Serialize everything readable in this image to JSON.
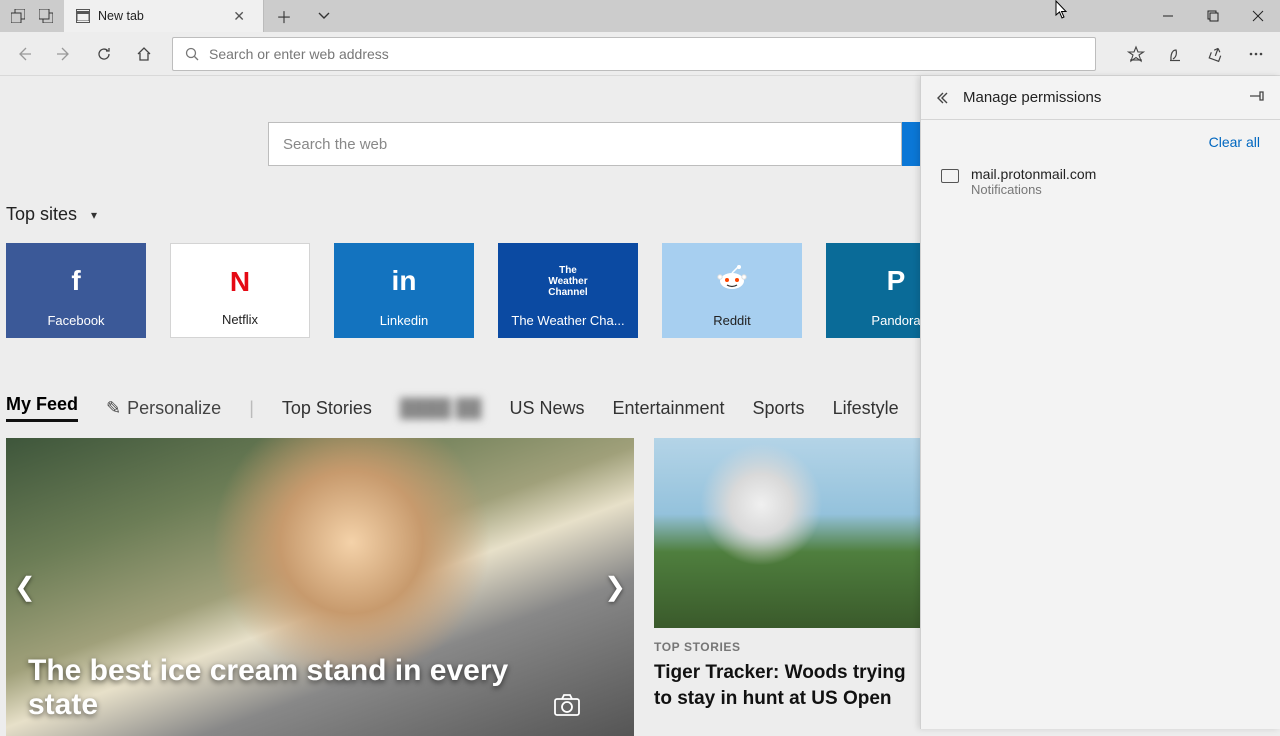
{
  "tab": {
    "title": "New tab"
  },
  "addressbar": {
    "placeholder": "Search or enter web address"
  },
  "websearch": {
    "placeholder": "Search the web"
  },
  "topsites": {
    "heading": "Top sites",
    "tiles": [
      {
        "label": "Facebook"
      },
      {
        "label": "Netflix"
      },
      {
        "label": "Linkedin"
      },
      {
        "label": "The Weather Cha..."
      },
      {
        "label": "Reddit"
      },
      {
        "label": "Pandora"
      }
    ]
  },
  "feed": {
    "tabs": {
      "my_feed": "My Feed",
      "personalize": "Personalize",
      "top_stories": "Top Stories",
      "us_news": "US News",
      "entertainment": "Entertainment",
      "sports": "Sports",
      "lifestyle": "Lifestyle",
      "money": "Money"
    },
    "hero": {
      "title": "The best ice cream stand in every state"
    },
    "story1": {
      "category": "TOP STORIES",
      "headline": "Tiger Tracker: Woods trying to stay in hunt at US Open"
    }
  },
  "panel": {
    "title": "Manage permissions",
    "clear_all": "Clear all",
    "items": [
      {
        "site": "mail.protonmail.com",
        "detail": "Notifications"
      }
    ]
  }
}
